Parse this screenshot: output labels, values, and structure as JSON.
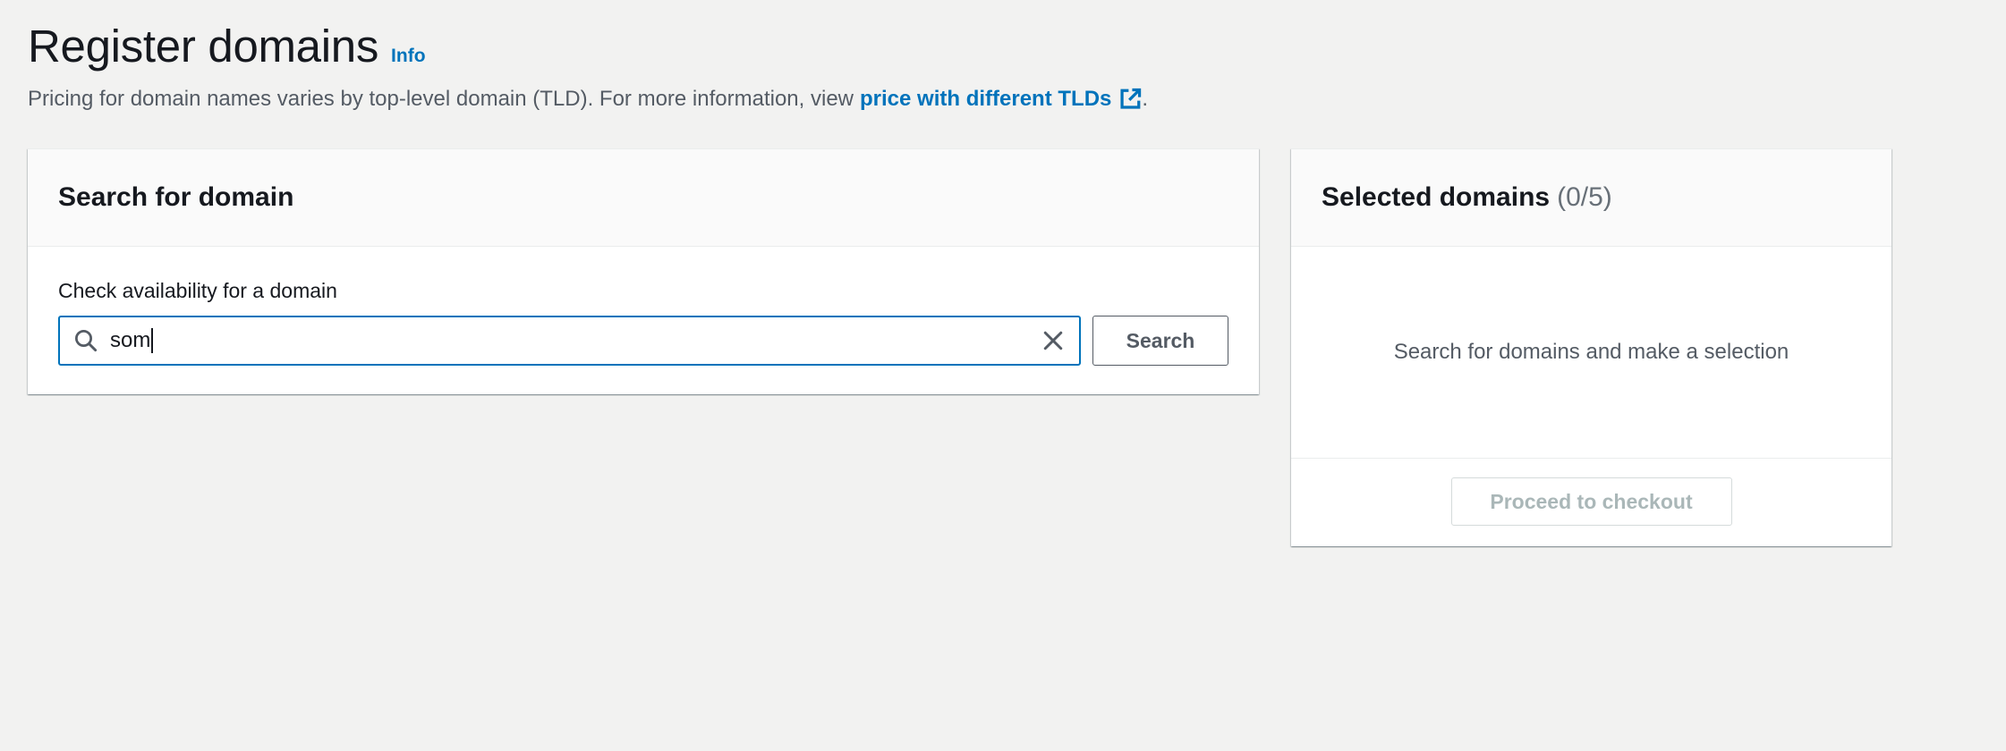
{
  "header": {
    "title": "Register domains",
    "info_label": "Info",
    "description_text": "Pricing for domain names varies by top-level domain (TLD). For more information, view",
    "description_link": "price with different TLDs",
    "description_end": ".",
    "link_icon": "external-link-icon"
  },
  "search_panel": {
    "title": "Search for domain",
    "field_label": "Check availability for a domain",
    "input_value": "som",
    "search_icon": "search-icon",
    "clear_icon": "close-icon",
    "search_button": "Search"
  },
  "selected_panel": {
    "title": "Selected domains",
    "counter": "(0/5)",
    "empty_message": "Search for domains and make a selection",
    "checkout_button": "Proceed to checkout",
    "checkout_disabled": true
  },
  "colors": {
    "page_background": "#f2f2f1",
    "link": "#0073bb",
    "input_focus_border": "#0073bb",
    "disabled_text": "#aab7b8"
  }
}
